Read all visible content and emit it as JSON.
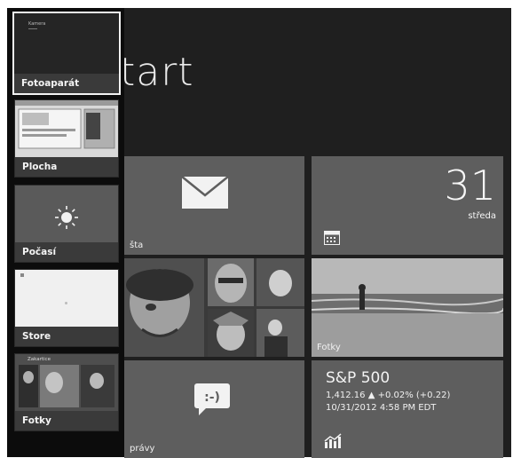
{
  "switcher": {
    "items": [
      {
        "label": "Fotoaparát",
        "thumb_text": "Kamera"
      },
      {
        "label": "Plocha"
      },
      {
        "label": "Počasí"
      },
      {
        "label": "Store"
      },
      {
        "label": "Fotky",
        "thumb_text": "Zakartice"
      }
    ]
  },
  "start": {
    "title": "tart"
  },
  "tiles": {
    "mail": {
      "caption": "šta",
      "icon": "envelope-icon"
    },
    "calendar": {
      "day_number": "31",
      "day_name": "středa",
      "icon": "calendar-icon"
    },
    "people": {
      "icon": "people-icon"
    },
    "photos": {
      "caption": "Fotky"
    },
    "messaging": {
      "caption": "právy",
      "emoticon": ":-)",
      "icon": "speech-bubble-icon"
    },
    "finance": {
      "title": "S&P 500",
      "quote": "1,412.16 ▲ +0.02% (+0.22)",
      "timestamp": "10/31/2012 4:58 PM EDT",
      "icon": "chart-icon"
    }
  },
  "colors": {
    "background": "#1f1f1f",
    "tile": "#5e5e5e",
    "switcher": "#0c0c0c",
    "active_border": "#f2f2f2"
  }
}
